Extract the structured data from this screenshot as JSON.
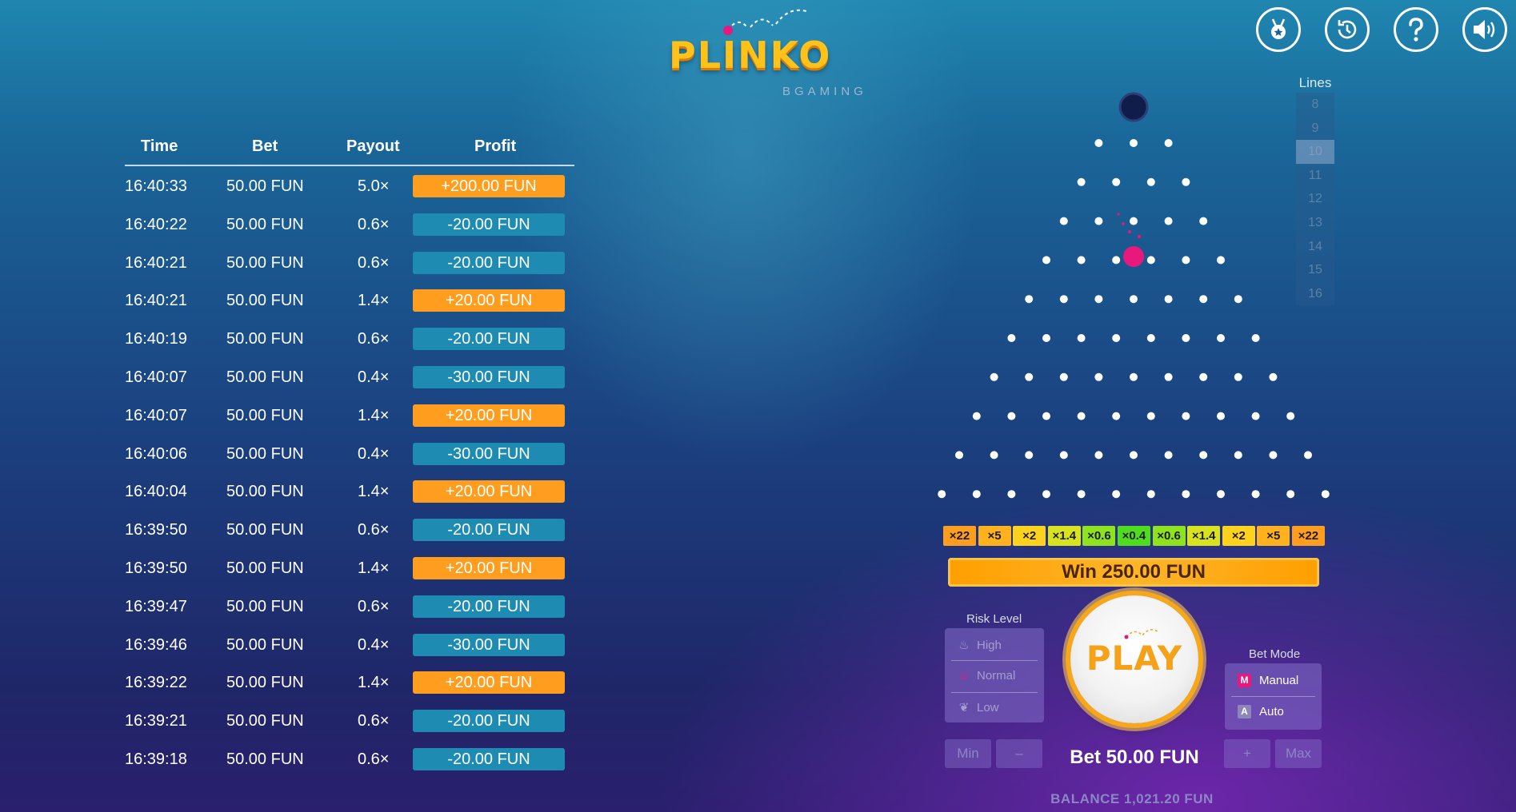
{
  "app": {
    "logo": {
      "title": "PLINKO",
      "subtitle": "BGAMING"
    }
  },
  "top_icons": [
    {
      "name": "achievements",
      "icon": "medal-icon"
    },
    {
      "name": "history",
      "icon": "history-icon"
    },
    {
      "name": "help",
      "icon": "question-icon"
    },
    {
      "name": "sound",
      "icon": "speaker-icon"
    }
  ],
  "history": {
    "headers": {
      "time": "Time",
      "bet": "Bet",
      "payout": "Payout",
      "profit": "Profit"
    },
    "rows": [
      {
        "time": "16:40:33",
        "bet": "50.00 FUN",
        "payout": "5.0×",
        "profit": "+200.00 FUN",
        "win": true
      },
      {
        "time": "16:40:22",
        "bet": "50.00 FUN",
        "payout": "0.6×",
        "profit": "-20.00 FUN",
        "win": false
      },
      {
        "time": "16:40:21",
        "bet": "50.00 FUN",
        "payout": "0.6×",
        "profit": "-20.00 FUN",
        "win": false
      },
      {
        "time": "16:40:21",
        "bet": "50.00 FUN",
        "payout": "1.4×",
        "profit": "+20.00 FUN",
        "win": true
      },
      {
        "time": "16:40:19",
        "bet": "50.00 FUN",
        "payout": "0.6×",
        "profit": "-20.00 FUN",
        "win": false
      },
      {
        "time": "16:40:07",
        "bet": "50.00 FUN",
        "payout": "0.4×",
        "profit": "-30.00 FUN",
        "win": false
      },
      {
        "time": "16:40:07",
        "bet": "50.00 FUN",
        "payout": "1.4×",
        "profit": "+20.00 FUN",
        "win": true
      },
      {
        "time": "16:40:06",
        "bet": "50.00 FUN",
        "payout": "0.4×",
        "profit": "-30.00 FUN",
        "win": false
      },
      {
        "time": "16:40:04",
        "bet": "50.00 FUN",
        "payout": "1.4×",
        "profit": "+20.00 FUN",
        "win": true
      },
      {
        "time": "16:39:50",
        "bet": "50.00 FUN",
        "payout": "0.6×",
        "profit": "-20.00 FUN",
        "win": false
      },
      {
        "time": "16:39:50",
        "bet": "50.00 FUN",
        "payout": "1.4×",
        "profit": "+20.00 FUN",
        "win": true
      },
      {
        "time": "16:39:47",
        "bet": "50.00 FUN",
        "payout": "0.6×",
        "profit": "-20.00 FUN",
        "win": false
      },
      {
        "time": "16:39:46",
        "bet": "50.00 FUN",
        "payout": "0.4×",
        "profit": "-30.00 FUN",
        "win": false
      },
      {
        "time": "16:39:22",
        "bet": "50.00 FUN",
        "payout": "1.4×",
        "profit": "+20.00 FUN",
        "win": true
      },
      {
        "time": "16:39:21",
        "bet": "50.00 FUN",
        "payout": "0.6×",
        "profit": "-20.00 FUN",
        "win": false
      },
      {
        "time": "16:39:18",
        "bet": "50.00 FUN",
        "payout": "0.6×",
        "profit": "-20.00 FUN",
        "win": false
      }
    ]
  },
  "lines": {
    "title": "Lines",
    "options": [
      "8",
      "9",
      "10",
      "11",
      "12",
      "13",
      "14",
      "15",
      "16"
    ],
    "selected": "10"
  },
  "board": {
    "rows": 10
  },
  "multipliers": [
    {
      "label": "×22",
      "color": "#ff9d1e"
    },
    {
      "label": "×5",
      "color": "#ffb21e"
    },
    {
      "label": "×2",
      "color": "#ffd21e"
    },
    {
      "label": "×1.4",
      "color": "#d8e21e"
    },
    {
      "label": "×0.6",
      "color": "#8ee21e"
    },
    {
      "label": "×0.4",
      "color": "#4fdc1e"
    },
    {
      "label": "×0.6",
      "color": "#8ee21e"
    },
    {
      "label": "×1.4",
      "color": "#d8e21e"
    },
    {
      "label": "×2",
      "color": "#ffd21e"
    },
    {
      "label": "×5",
      "color": "#ffb21e"
    },
    {
      "label": "×22",
      "color": "#ff9d1e"
    }
  ],
  "win_banner": "Win 250.00 FUN",
  "risk": {
    "title": "Risk Level",
    "options": [
      {
        "label": "High",
        "icon": "flame-icon"
      },
      {
        "label": "Normal",
        "icon": "smile-icon"
      },
      {
        "label": "Low",
        "icon": "leaf-icon"
      }
    ]
  },
  "play_label": "PLAY",
  "bet_mode": {
    "title": "Bet Mode",
    "options": [
      {
        "badge": "M",
        "label": "Manual",
        "color": "#e8197d"
      },
      {
        "badge": "A",
        "label": "Auto",
        "color": "#8d86b8"
      }
    ]
  },
  "bet": {
    "min": "Min",
    "minus": "–",
    "value": "Bet 50.00 FUN",
    "plus": "+",
    "max": "Max"
  },
  "balance": "BALANCE 1,021.20 FUN",
  "colors": {
    "win": "#ff9d1e",
    "loss": "#1e8cb2",
    "ball": "#e8197d",
    "accent": "#f5a21a"
  }
}
